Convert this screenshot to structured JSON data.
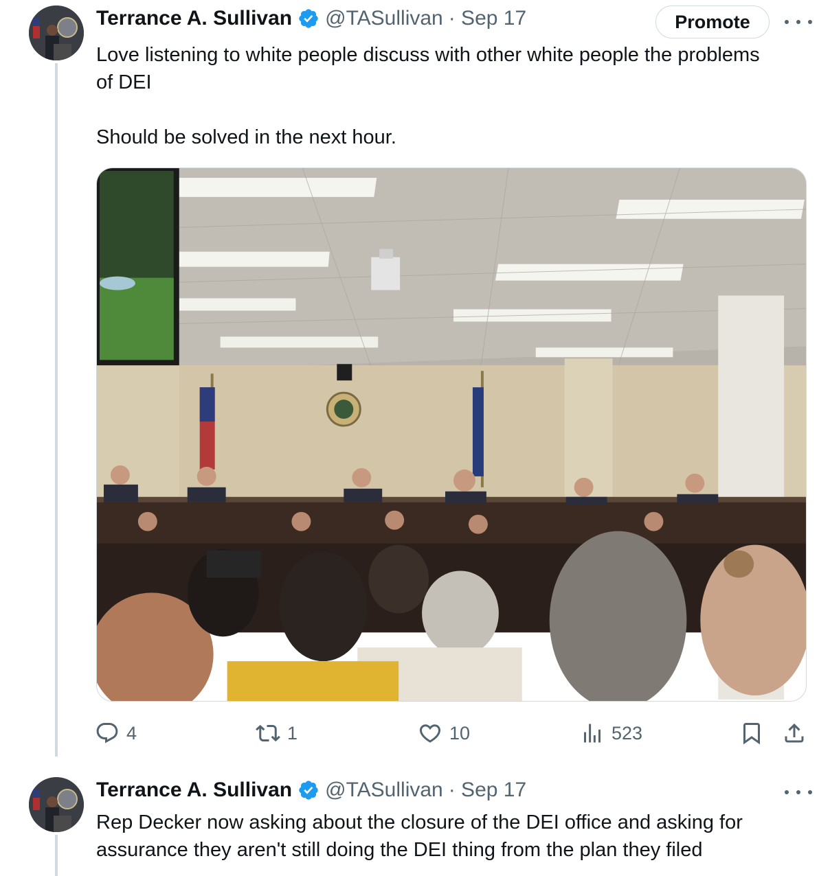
{
  "tweets": [
    {
      "author_name": "Terrance A. Sullivan",
      "handle": "@TASullivan",
      "date": "· Sep 17",
      "text": "Love listening to white people discuss with other white people the problems of DEI\n\nShould be solved in the next hour.",
      "promote_label": "Promote",
      "stats": {
        "replies": "4",
        "reposts": "1",
        "likes": "10",
        "views": "523"
      },
      "media_description_icon": "photo-hearing-room"
    },
    {
      "author_name": "Terrance A. Sullivan",
      "handle": "@TASullivan",
      "date": "· Sep 17",
      "text": "Rep Decker now asking about the closure of the DEI office and asking for assurance they aren't still doing the DEI thing from the plan they filed"
    }
  ],
  "colors": {
    "text_primary": "#0f1419",
    "text_secondary": "#536471",
    "verified_blue": "#1d9bf0",
    "border": "#cfd9de"
  },
  "icons": {
    "reply": "reply-icon",
    "repost": "repost-icon",
    "like": "heart-icon",
    "views": "views-icon",
    "bookmark": "bookmark-icon",
    "share": "share-icon",
    "verified": "verified-badge-icon",
    "more": "more-options-icon"
  }
}
